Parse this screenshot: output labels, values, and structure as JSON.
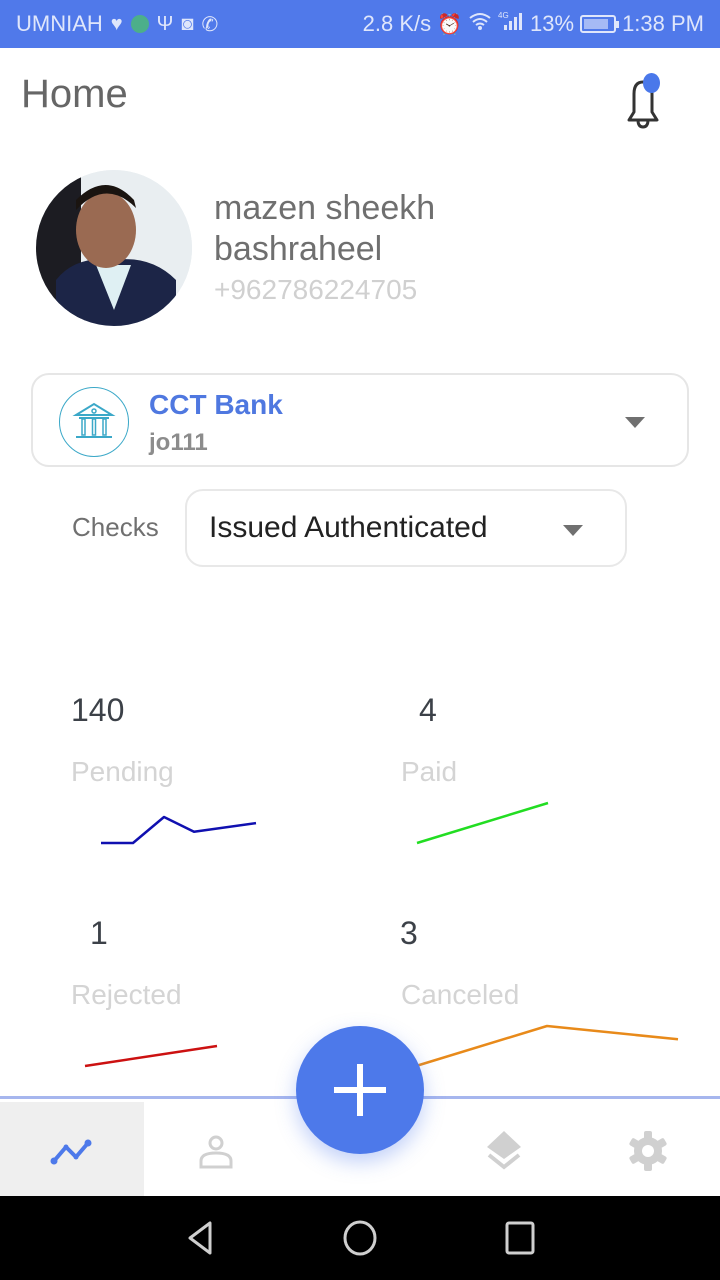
{
  "status_bar": {
    "carrier": "UMNIAH",
    "left_icons": [
      "heart-pulse-icon",
      "vpn-globe-icon",
      "usb-icon",
      "camera-icon",
      "whatsapp-icon"
    ],
    "net_speed": "2.8 K/s",
    "right_icons": [
      "alarm-icon",
      "wifi-icon",
      "signal-4g-icon"
    ],
    "network_type": "4G",
    "battery": "13%",
    "time": "1:38 PM"
  },
  "header": {
    "title": "Home",
    "notification_icon": "bell-icon",
    "has_unread": true
  },
  "profile": {
    "name": "mazen sheekh bashraheel",
    "phone": "+962786224705"
  },
  "bank_selector": {
    "bank_name": "CCT Bank",
    "account_code": "jo111",
    "icon": "bank-building-icon"
  },
  "checks_filter": {
    "label": "Checks",
    "selected": "Issued Authenticated"
  },
  "stats": [
    {
      "label": "Pending",
      "value": "140",
      "color": "#1010b0",
      "trend": [
        0,
        0,
        3,
        1.3,
        2.3
      ]
    },
    {
      "label": "Paid",
      "value": "4",
      "color": "#22dd22",
      "trend": [
        0,
        4
      ]
    },
    {
      "label": "Rejected",
      "value": "1",
      "color": "#cc1111",
      "trend": [
        0,
        1
      ]
    },
    {
      "label": "Canceled",
      "value": "3",
      "color": "#e88a1a",
      "trend": [
        0,
        3,
        2
      ]
    }
  ],
  "bottom_nav": {
    "items": [
      {
        "name": "dashboard",
        "icon": "chart-line-icon",
        "active": true
      },
      {
        "name": "profile",
        "icon": "user-icon",
        "active": false
      },
      {
        "name": "add",
        "icon": "plus-icon",
        "active": false
      },
      {
        "name": "layers",
        "icon": "layers-icon",
        "active": false
      },
      {
        "name": "settings",
        "icon": "gear-icon",
        "active": false
      }
    ]
  },
  "colors": {
    "accent": "#4d79ea",
    "status_bar": "#5079ea"
  }
}
